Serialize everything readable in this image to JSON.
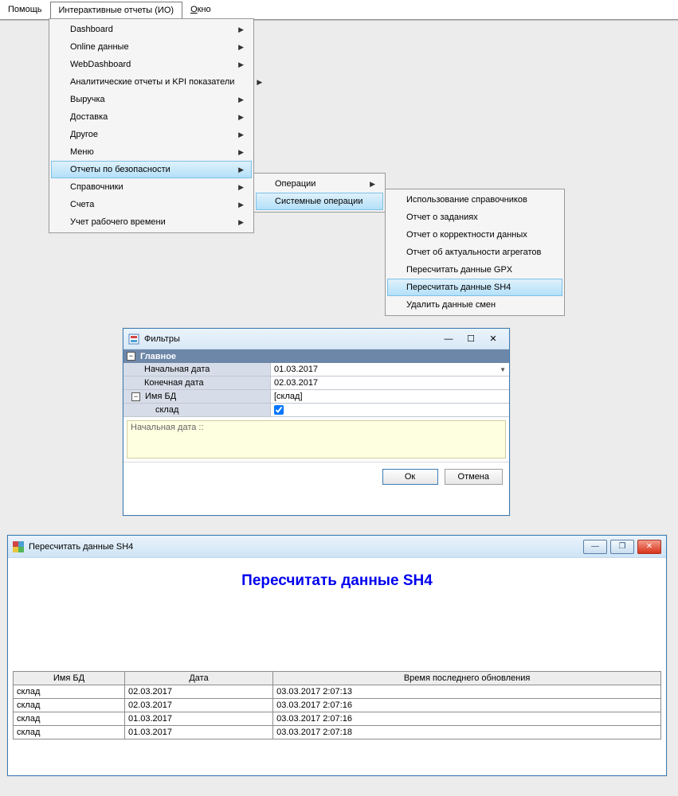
{
  "menubar": {
    "help": "Помощь",
    "io": "Интерактивные отчеты (ИО)",
    "window_pre": "О",
    "window_post": "кно"
  },
  "dd1": [
    {
      "label": "Dashboard",
      "sub": true,
      "hl": false
    },
    {
      "label": "Online данные",
      "sub": true,
      "hl": false
    },
    {
      "label": "WebDashboard",
      "sub": true,
      "hl": false
    },
    {
      "label": "Аналитические отчеты и KPI показатели",
      "sub": true,
      "hl": false
    },
    {
      "label": "Выручка",
      "sub": true,
      "hl": false
    },
    {
      "label": "Доставка",
      "sub": true,
      "hl": false
    },
    {
      "label": "Другое",
      "sub": true,
      "hl": false
    },
    {
      "label": "Меню",
      "sub": true,
      "hl": false
    },
    {
      "label": "Отчеты по безопасности",
      "sub": true,
      "hl": true
    },
    {
      "label": "Справочники",
      "sub": true,
      "hl": false
    },
    {
      "label": "Счета",
      "sub": true,
      "hl": false
    },
    {
      "label": "Учет рабочего времени",
      "sub": true,
      "hl": false
    }
  ],
  "dd2": [
    {
      "label": "Операции",
      "sub": true,
      "hl": false
    },
    {
      "label": "Системные операции",
      "sub": true,
      "hl": true
    }
  ],
  "dd3": [
    {
      "label": "Использование справочников",
      "hl": false
    },
    {
      "label": "Отчет о заданиях",
      "hl": false
    },
    {
      "label": "Отчет о корректности данных",
      "hl": false
    },
    {
      "label": "Отчет об актуальности агрегатов",
      "hl": false
    },
    {
      "label": "Пересчитать данные GPX",
      "hl": false
    },
    {
      "label": "Пересчитать данные SH4",
      "hl": true
    },
    {
      "label": "Удалить данные смен",
      "hl": false
    }
  ],
  "filters": {
    "title": "Фильтры",
    "section": "Главное",
    "rows": {
      "start_label": "Начальная дата",
      "start_value": "01.03.2017",
      "end_label": "Конечная дата",
      "end_value": "02.03.2017",
      "dbname_label": "Имя БД",
      "dbname_value": "[склад]",
      "store_label": "склад",
      "store_checked": true
    },
    "note": "Начальная дата ::",
    "ok": "Ок",
    "cancel": "Отмена"
  },
  "report": {
    "title": "Пересчитать данные SH4",
    "heading": "Пересчитать данные SH4",
    "columns": [
      "Имя БД",
      "Дата",
      "Время последнего обновления"
    ],
    "rows": [
      [
        "склад",
        "02.03.2017",
        "03.03.2017 2:07:13"
      ],
      [
        "склад",
        "02.03.2017",
        "03.03.2017 2:07:16"
      ],
      [
        "склад",
        "01.03.2017",
        "03.03.2017 2:07:16"
      ],
      [
        "склад",
        "01.03.2017",
        "03.03.2017 2:07:18"
      ]
    ]
  }
}
